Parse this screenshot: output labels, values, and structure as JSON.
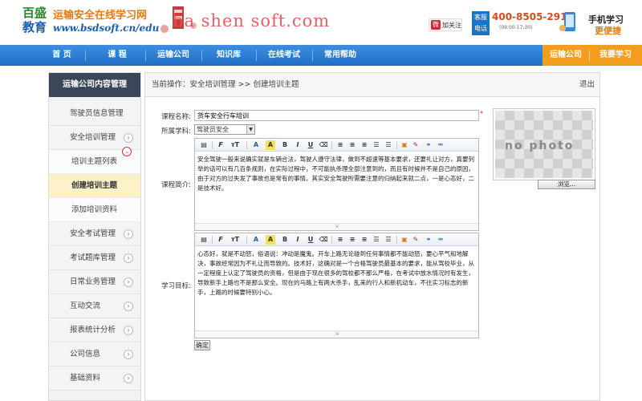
{
  "header": {
    "logo_line1": "百盛",
    "logo_line2": "教育",
    "site_title": "运输安全在线学习网",
    "site_url": "www.bsdsoft.cn/edu",
    "watermark": "ba shen soft.com",
    "follow_label": "加关注",
    "hotline_tag": "客服电话",
    "phone": "400-8505-291",
    "phone_hours": "(09:00-17:30)",
    "mobile_line1": "手机学习",
    "mobile_line2": "更便捷"
  },
  "nav": {
    "items": [
      "首 页",
      "课 程",
      "运输公司",
      "知识库",
      "在线考试",
      "常用帮助"
    ],
    "right_items": [
      "运输公司",
      "我要学习"
    ]
  },
  "sidebar": {
    "title": "运输公司内容管理",
    "items": [
      {
        "label": "驾驶员信息管理"
      },
      {
        "label": "安全培训管理"
      },
      {
        "label": "安全考试管理"
      },
      {
        "label": "考试题库管理"
      },
      {
        "label": "日常业务管理"
      },
      {
        "label": "互动交流"
      },
      {
        "label": "报表统计分析"
      },
      {
        "label": "公司信息"
      },
      {
        "label": "基础资料"
      }
    ],
    "sub_items": [
      "培训主题列表",
      "创建培训主题",
      "添加培训资料"
    ]
  },
  "main": {
    "breadcrumb": "当前操作：安全培训管理 >> 创建培训主题",
    "exit": "退出",
    "form": {
      "name_label": "课程名称:",
      "name_value": "货车安全行车培训",
      "subject_label": "所属学科:",
      "subject_value": "驾驶员安全",
      "intro_label": "课程简介:",
      "intro_text": "安全驾驶一般来说确实就是车辆合法，驾驶人遵守法律，做到不超速等基本要求，还要礼让对方，真要列举的话可以有几百条规则，在实际过程中，不可能执杀理全部注意到的，而且有时候并不是自己的原因，由于对方的过失发了事故也是常有的事情。其实安全驾驶所需要注意的归纳起来就二点，一是心态好，二是技术好。",
      "goal_label": "学习目标:",
      "goal_text": "心态好，就是不动怒，俗语说：冲动是魔鬼。开车上路无论碰到任何事情都不能动怒，要心平气和地解决，事故经常因为不礼让而导致的。技术好，这确对是一个合格驾驶员最基本的要求，能从驾校毕业，从一定程度上认定了驾驶员的资格，但是由于现在很多的驾校都不那么严格，在考试中放水情况时有发生，导致新手上路也不是那么安全。现在的马路上有两大杀手，乱来的行人和新机动车，不往实习标志的新手，上路的时候要特别小心。",
      "browse_label": "浏览...",
      "ok_label": "确定",
      "photo_placeholder": "no photo"
    },
    "toolbar_icons": [
      "source-icon",
      "font-family-icon",
      "font-size-icon",
      "font-color-icon",
      "highlight-icon",
      "bold-icon",
      "italic-icon",
      "underline-icon",
      "eraser-icon",
      "align-left-icon",
      "align-center-icon",
      "align-right-icon",
      "ordered-list-icon",
      "unordered-list-icon",
      "image-icon",
      "flash-icon",
      "link-icon",
      "unlink-icon"
    ]
  },
  "colors": {
    "nav_blue": "#1f6fc8",
    "nav_orange": "#f39c1e",
    "sidebar_head": "#3a4758",
    "active_sub": "#fdf1c8"
  }
}
